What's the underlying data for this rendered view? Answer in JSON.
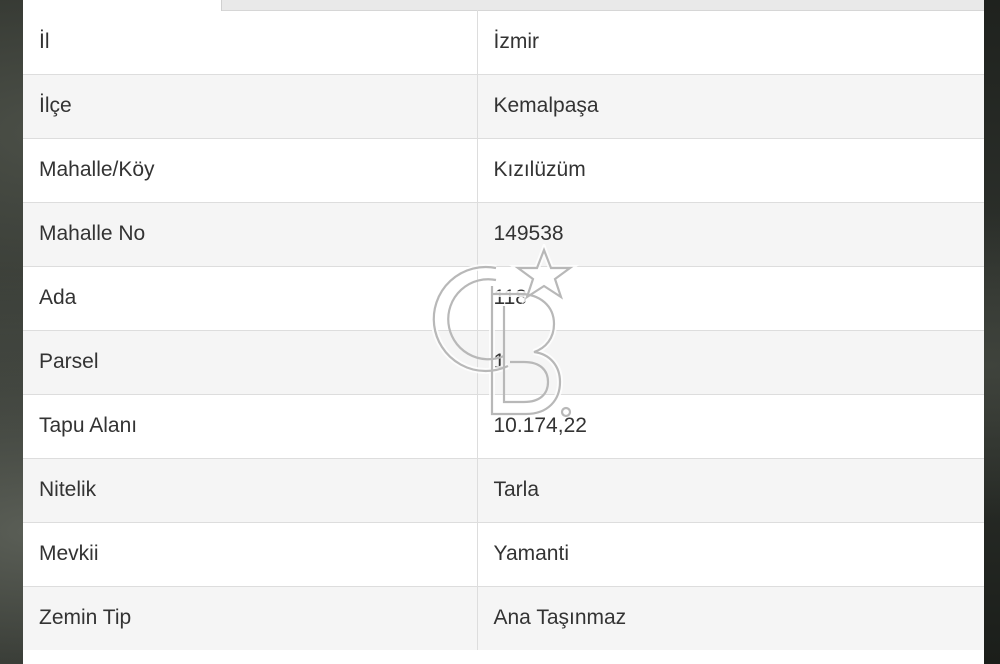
{
  "table": {
    "rows": [
      {
        "label": "İl",
        "value": "İzmir"
      },
      {
        "label": "İlçe",
        "value": "Kemalpaşa"
      },
      {
        "label": "Mahalle/Köy",
        "value": "Kızılüzüm"
      },
      {
        "label": "Mahalle No",
        "value": "149538"
      },
      {
        "label": "Ada",
        "value": "118"
      },
      {
        "label": "Parsel",
        "value": "1"
      },
      {
        "label": "Tapu Alanı",
        "value": "10.174,22"
      },
      {
        "label": "Nitelik",
        "value": "Tarla"
      },
      {
        "label": "Mevkii",
        "value": "Yamanti"
      },
      {
        "label": "Zemin Tip",
        "value": "Ana Taşınmaz"
      }
    ]
  },
  "watermark": {
    "icon": "cb-logo-icon",
    "color": "#b8b8b8"
  }
}
